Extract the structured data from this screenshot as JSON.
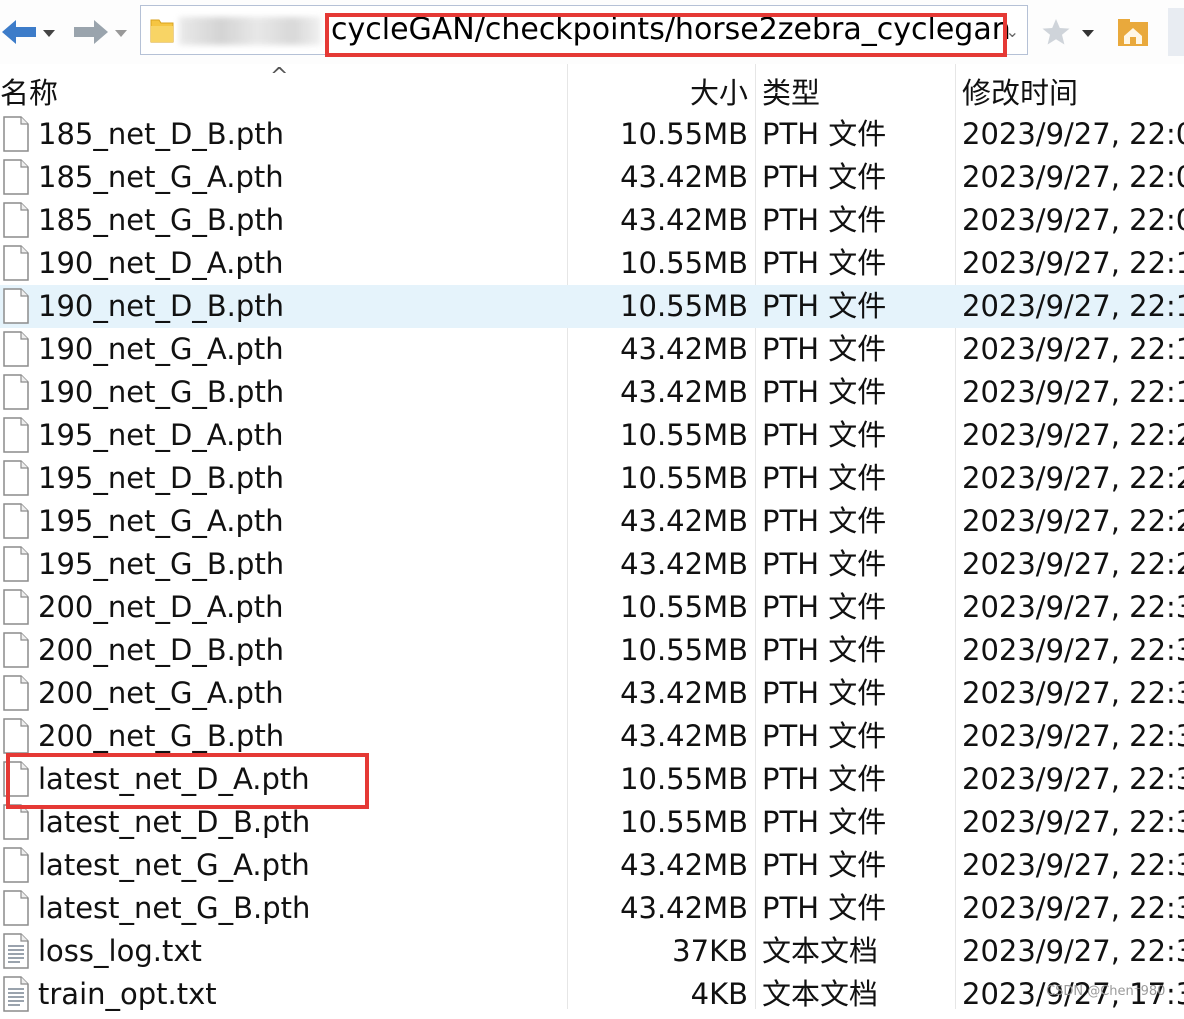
{
  "address_bar": {
    "path": "cycleGAN/checkpoints/horse2zebra_cyclegan",
    "dropdown_glyph": "⌄"
  },
  "columns": {
    "name": "名称",
    "size": "大小",
    "type": "类型",
    "modified": "修改时间"
  },
  "sort_indicator": "^",
  "files": [
    {
      "name": "185_net_D_B.pth",
      "size": "10.55MB",
      "type": "PTH 文件",
      "modified": "2023/9/27, 22:0",
      "icon": "file-icon"
    },
    {
      "name": "185_net_G_A.pth",
      "size": "43.42MB",
      "type": "PTH 文件",
      "modified": "2023/9/27, 22:0",
      "icon": "file-icon"
    },
    {
      "name": "185_net_G_B.pth",
      "size": "43.42MB",
      "type": "PTH 文件",
      "modified": "2023/9/27, 22:0",
      "icon": "file-icon"
    },
    {
      "name": "190_net_D_A.pth",
      "size": "10.55MB",
      "type": "PTH 文件",
      "modified": "2023/9/27, 22:1",
      "icon": "file-icon"
    },
    {
      "name": "190_net_D_B.pth",
      "size": "10.55MB",
      "type": "PTH 文件",
      "modified": "2023/9/27, 22:1",
      "icon": "file-icon",
      "selected": true
    },
    {
      "name": "190_net_G_A.pth",
      "size": "43.42MB",
      "type": "PTH 文件",
      "modified": "2023/9/27, 22:1",
      "icon": "file-icon"
    },
    {
      "name": "190_net_G_B.pth",
      "size": "43.42MB",
      "type": "PTH 文件",
      "modified": "2023/9/27, 22:1",
      "icon": "file-icon"
    },
    {
      "name": "195_net_D_A.pth",
      "size": "10.55MB",
      "type": "PTH 文件",
      "modified": "2023/9/27, 22:2",
      "icon": "file-icon"
    },
    {
      "name": "195_net_D_B.pth",
      "size": "10.55MB",
      "type": "PTH 文件",
      "modified": "2023/9/27, 22:2",
      "icon": "file-icon"
    },
    {
      "name": "195_net_G_A.pth",
      "size": "43.42MB",
      "type": "PTH 文件",
      "modified": "2023/9/27, 22:2",
      "icon": "file-icon"
    },
    {
      "name": "195_net_G_B.pth",
      "size": "43.42MB",
      "type": "PTH 文件",
      "modified": "2023/9/27, 22:2",
      "icon": "file-icon"
    },
    {
      "name": "200_net_D_A.pth",
      "size": "10.55MB",
      "type": "PTH 文件",
      "modified": "2023/9/27, 22:3",
      "icon": "file-icon"
    },
    {
      "name": "200_net_D_B.pth",
      "size": "10.55MB",
      "type": "PTH 文件",
      "modified": "2023/9/27, 22:3",
      "icon": "file-icon"
    },
    {
      "name": "200_net_G_A.pth",
      "size": "43.42MB",
      "type": "PTH 文件",
      "modified": "2023/9/27, 22:3",
      "icon": "file-icon"
    },
    {
      "name": "200_net_G_B.pth",
      "size": "43.42MB",
      "type": "PTH 文件",
      "modified": "2023/9/27, 22:3",
      "icon": "file-icon"
    },
    {
      "name": "latest_net_D_A.pth",
      "size": "10.55MB",
      "type": "PTH 文件",
      "modified": "2023/9/27, 22:3",
      "icon": "file-icon"
    },
    {
      "name": "latest_net_D_B.pth",
      "size": "10.55MB",
      "type": "PTH 文件",
      "modified": "2023/9/27, 22:3",
      "icon": "file-icon"
    },
    {
      "name": "latest_net_G_A.pth",
      "size": "43.42MB",
      "type": "PTH 文件",
      "modified": "2023/9/27, 22:3",
      "icon": "file-icon"
    },
    {
      "name": "latest_net_G_B.pth",
      "size": "43.42MB",
      "type": "PTH 文件",
      "modified": "2023/9/27, 22:3",
      "icon": "file-icon"
    },
    {
      "name": "loss_log.txt",
      "size": "37KB",
      "type": "文本文档",
      "modified": "2023/9/27, 22:3",
      "icon": "text-file-icon"
    },
    {
      "name": "train_opt.txt",
      "size": "4KB",
      "type": "文本文档",
      "modified": "2023/9/27, 17:3",
      "icon": "text-file-icon"
    }
  ],
  "watermark": "CSDN @Chen⁺980",
  "colors": {
    "highlight_box": "#e53935",
    "selected_row": "#e5f3fb",
    "nav_arrow": "#3d7cc9",
    "folder_yellow": "#f5c542"
  }
}
